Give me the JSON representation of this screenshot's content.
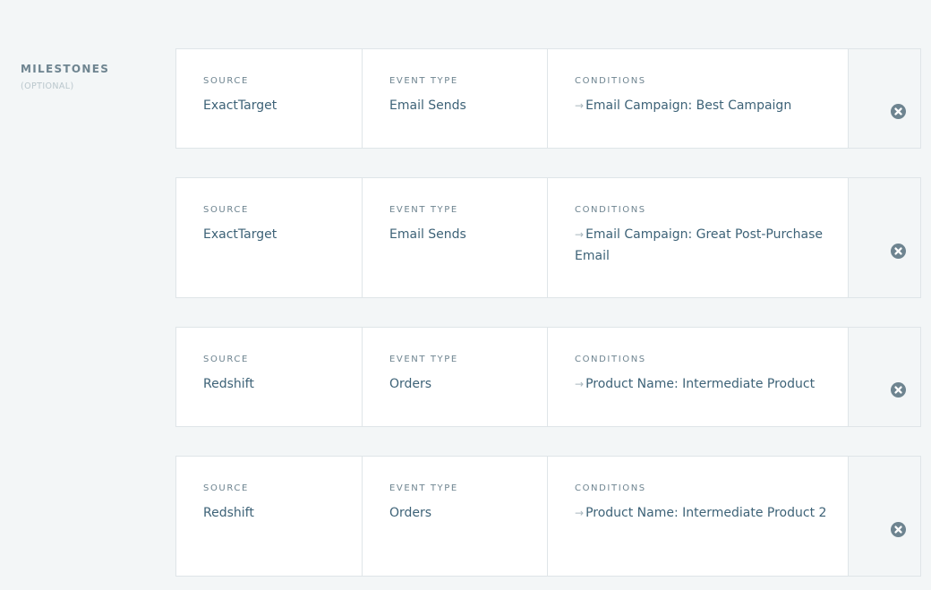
{
  "section": {
    "title": "MILESTONES",
    "subtitle": "(OPTIONAL)"
  },
  "labels": {
    "source": "SOURCE",
    "event_type": "EVENT TYPE",
    "conditions": "CONDITIONS"
  },
  "icons": {
    "condition_arrow": "arrow-right-icon",
    "remove": "close-circle-icon"
  },
  "colors": {
    "background": "#f3f6f7",
    "card": "#ffffff",
    "value_text": "#3d6277",
    "label_text": "#6e8490",
    "remove_icon": "#6e8490"
  },
  "milestones": [
    {
      "source": "ExactTarget",
      "event_type": "Email Sends",
      "condition": "Email Campaign: Best Campaign"
    },
    {
      "source": "ExactTarget",
      "event_type": "Email Sends",
      "condition": "Email Campaign: Great Post-Purchase Email"
    },
    {
      "source": "Redshift",
      "event_type": "Orders",
      "condition": "Product Name: Intermediate Product"
    },
    {
      "source": "Redshift",
      "event_type": "Orders",
      "condition": "Product Name: Intermediate Product 2"
    }
  ]
}
